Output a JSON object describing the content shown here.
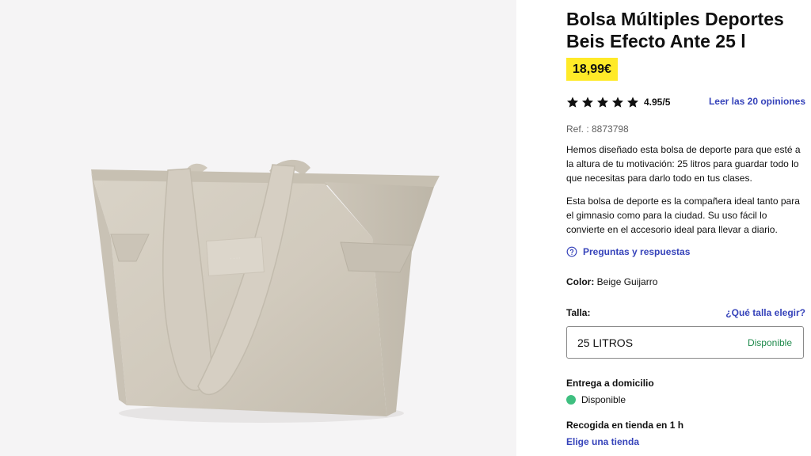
{
  "product": {
    "title_line1": "Bolsa Múltiples Deportes",
    "title_line2": "Beis Efecto Ante 25 l",
    "price": "18,99€",
    "image_alt": "bag-image",
    "rating": {
      "value": "4.95/5",
      "stars": 5,
      "reviews_link": "Leer las 20 opiniones"
    },
    "ref": "Ref. : 8873798",
    "description_1": "Hemos diseñado esta bolsa de deporte para que esté a la altura de tu motivación: 25 litros para guardar todo lo que necesitas para darlo todo en tus clases.",
    "description_2": "Esta bolsa de deporte es la compañera ideal tanto para el gimnasio como para la ciudad. Su uso fácil lo convierte en el accesorio ideal para llevar a diario.",
    "qa_link": "Preguntas y respuestas",
    "color_label": "Color:",
    "color_value": "Beige Guijarro",
    "size_label": "Talla:",
    "size_help": "¿Qué talla elegir?",
    "size_value": "25 LITROS",
    "size_availability": "Disponible",
    "delivery_label": "Entrega a domicilio",
    "delivery_status": "Disponible",
    "pickup_label": "Recogida en tienda en 1 h",
    "store_link": "Elige una tienda"
  },
  "colors": {
    "price_bg": "#ffea28",
    "link": "#3643ba",
    "available_text": "#1f8a4c",
    "available_dot": "#3fbf80",
    "image_bg": "#f5f4f5"
  },
  "icons": [
    "star-icon",
    "question-circle-icon",
    "status-dot-icon"
  ]
}
